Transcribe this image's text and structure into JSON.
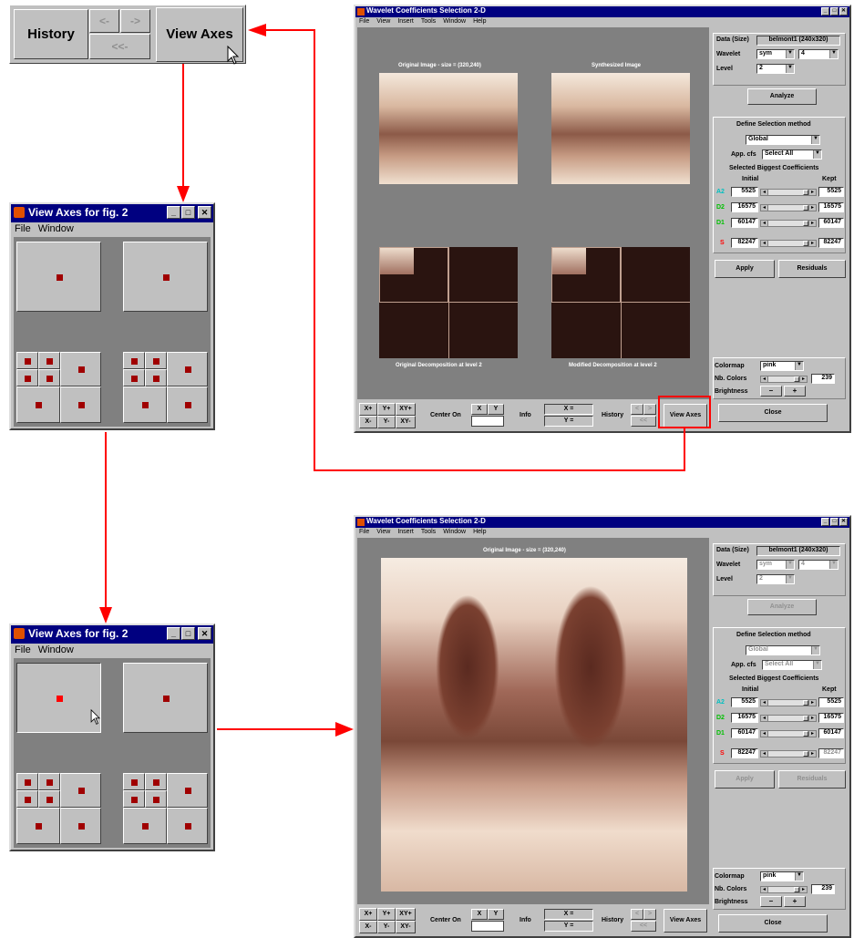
{
  "zoom_bar": {
    "history": "History",
    "back": "<-",
    "forward": "->",
    "first": "<<-",
    "view_axes": "View Axes"
  },
  "view_axes_win": {
    "title": "View Axes for fig. 2",
    "menu": [
      "File",
      "Window"
    ]
  },
  "main_win": {
    "title": "Wavelet Coefficients Selection 2-D",
    "menu": [
      "File",
      "View",
      "Insert",
      "Tools",
      "Window",
      "Help"
    ],
    "title_original": "Original Image - size = (320,240)",
    "title_synth": "Synthesized Image",
    "title_orig_dec": "Original Decomposition at level 2",
    "title_mod_dec": "Modified Decomposition at level 2"
  },
  "panel": {
    "data_label": "Data (Size)",
    "data_value": "belmont1 (240x320)",
    "wavelet_label": "Wavelet",
    "wavelet_family": "sym",
    "wavelet_order": "4",
    "level_label": "Level",
    "level_value": "2",
    "analyze": "Analyze",
    "define_method": "Define Selection method",
    "method_value": "Global",
    "app_cfs_label": "App. cfs",
    "app_cfs_value": "Select All",
    "selected_biggest": "Selected Biggest Coefficients",
    "initial": "Initial",
    "kept": "Kept",
    "rows": [
      {
        "name": "A2",
        "initial": "5525",
        "kept": "5525",
        "color": "#00c0c0"
      },
      {
        "name": "D2",
        "initial": "16575",
        "kept": "16575",
        "color": "#00c000"
      },
      {
        "name": "D1",
        "initial": "60147",
        "kept": "60147",
        "color": "#00c000"
      }
    ],
    "sum_row": {
      "name": "S",
      "initial": "82247",
      "kept": "82247",
      "color": "#ff0000"
    },
    "apply": "Apply",
    "residuals": "Residuals",
    "colormap_label": "Colormap",
    "colormap_value": "pink",
    "nb_colors_label": "Nb. Colors",
    "nb_colors_value": "239",
    "brightness_label": "Brightness",
    "minus": "–",
    "plus": "+",
    "close": "Close"
  },
  "bottom_bar": {
    "xp": "X+",
    "yp": "Y+",
    "xyp": "XY+",
    "xm": "X-",
    "ym": "Y-",
    "xym": "XY-",
    "center_on": "Center On",
    "x": "X",
    "y": "Y",
    "info": "Info",
    "x_eq": "X =",
    "y_eq": "Y =",
    "history": "History",
    "back": "<",
    "forward": ">",
    "first": "<<",
    "view_axes": "View Axes"
  },
  "colors": {
    "title_bar": "#000080",
    "window_bg": "#c0c0c0",
    "axes_bg": "#808080",
    "highlight": "#ff0000",
    "dot": "#a00000"
  }
}
